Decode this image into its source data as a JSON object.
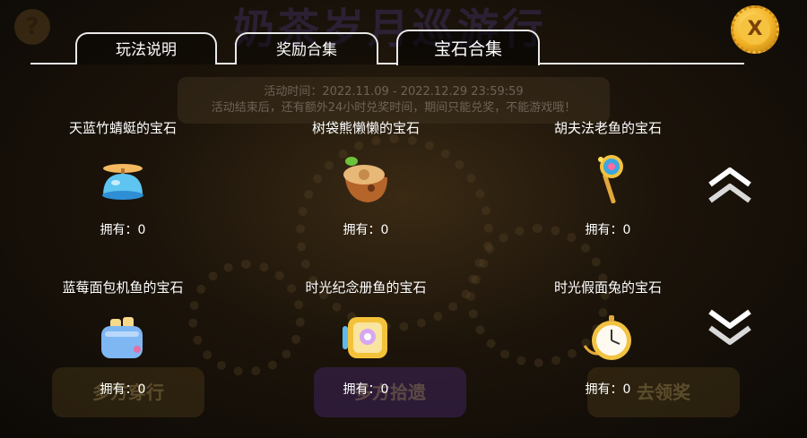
{
  "background": {
    "title": "奶茶岁月巡游行",
    "notice_line1": "活动时间：2022.11.09 - 2022.12.29 23:59:59",
    "notice_line2": "活动结束后，还有额外24小时兑奖时间，期间只能兑奖，不能游戏哦！",
    "left_button": "多方穿行",
    "middle_button": "多方拾遗",
    "right_button": "去领奖"
  },
  "close_button": {
    "label": "X"
  },
  "tabs": [
    {
      "label": "玩法说明",
      "active": false
    },
    {
      "label": "奖励合集",
      "active": false
    },
    {
      "label": "宝石合集",
      "active": true
    }
  ],
  "gems": [
    {
      "name": "天蓝竹蜻蜓的宝石",
      "owned": "拥有：0",
      "icon": "blue-propeller-hat-icon"
    },
    {
      "name": "树袋熊懒懒的宝石",
      "owned": "拥有：0",
      "icon": "acorn-log-icon"
    },
    {
      "name": "胡夫法老鱼的宝石",
      "owned": "拥有：0",
      "icon": "pharaoh-scepter-icon"
    },
    {
      "name": "蓝莓面包机鱼的宝石",
      "owned": "拥有：0",
      "icon": "toaster-icon"
    },
    {
      "name": "时光纪念册鱼的宝石",
      "owned": "拥有：0",
      "icon": "memory-album-icon"
    },
    {
      "name": "时光假面兔的宝石",
      "owned": "拥有：0",
      "icon": "pocket-watch-icon"
    }
  ],
  "scroll": {
    "up_icon": "double-chevron-up-icon",
    "down_icon": "double-chevron-down-icon"
  },
  "colors": {
    "tab_border": "#e9e9e9",
    "close_gold": "#f3b324",
    "text": "#ffffff"
  }
}
